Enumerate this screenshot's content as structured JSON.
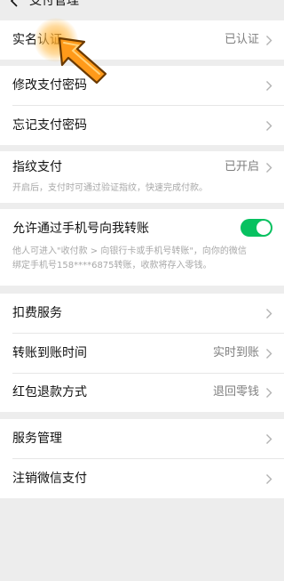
{
  "header": {
    "title": "支付管理"
  },
  "group1": {
    "realname": {
      "label": "实名认证",
      "value": "已认证"
    }
  },
  "group2": {
    "change_pwd": {
      "label": "修改支付密码"
    },
    "forgot_pwd": {
      "label": "忘记支付密码"
    }
  },
  "group3": {
    "fingerprint": {
      "label": "指纹支付",
      "value": "已开启",
      "desc": "开启后，支付时可通过验证指纹，快速完成付款。"
    }
  },
  "group4": {
    "transfer_phone": {
      "label": "允许通过手机号向我转账",
      "toggle_on": true,
      "desc_line1": "他人可进入\"收付款 > 向银行卡或手机号转账\"，向你的微信",
      "desc_line2": "绑定手机号158****6875转账，收款将存入零钱。"
    }
  },
  "group5": {
    "deduction": {
      "label": "扣费服务"
    },
    "arrival_time": {
      "label": "转账到账时间",
      "value": "实时到账"
    },
    "refund_method": {
      "label": "红包退款方式",
      "value": "退回零钱"
    }
  },
  "group6": {
    "service_mgmt": {
      "label": "服务管理"
    },
    "cancel_pay": {
      "label": "注销微信支付"
    }
  },
  "colors": {
    "accent": "#07c160",
    "background": "#ededed",
    "highlight": "#ff9a1a"
  }
}
